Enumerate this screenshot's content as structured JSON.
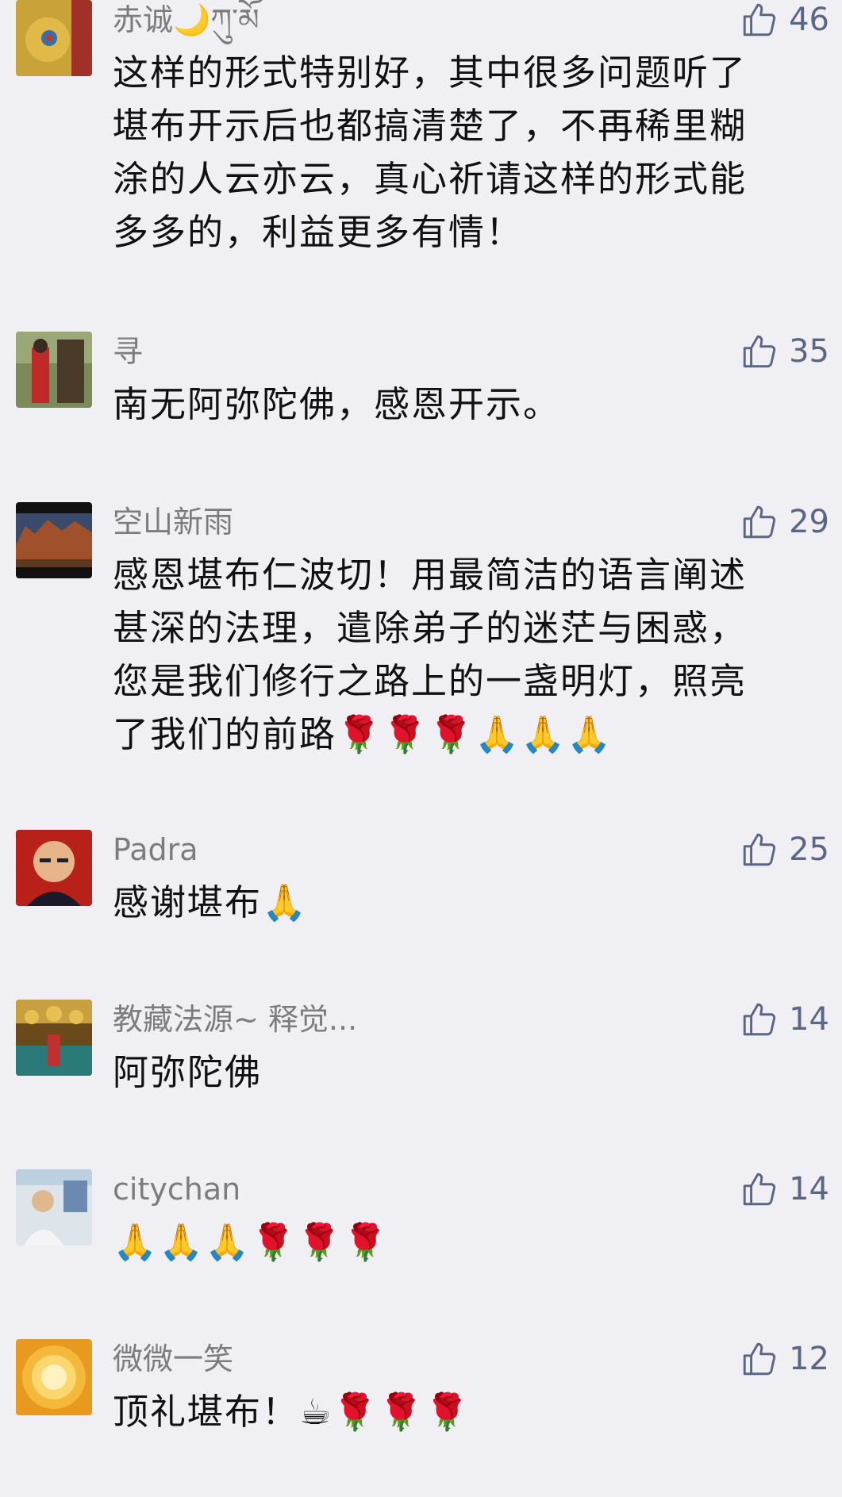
{
  "comments": [
    {
      "name": "赤诚🌙ཀུ་མོ",
      "likes": "46",
      "lines": [
        "这样的形式特别好，其中很多问题听了",
        "堪布开示后也都搞清楚了，不再稀里糊",
        "涂的人云亦云，真心祈请这样的形式能",
        "多多的，利益更多有情！"
      ]
    },
    {
      "name": "寻",
      "likes": "35",
      "lines": [
        "南无阿弥陀佛，感恩开示。"
      ]
    },
    {
      "name": "空山新雨",
      "likes": "29",
      "lines": [
        "感恩堪布仁波切！用最简洁的语言阐述",
        "甚深的法理，遣除弟子的迷茫与困惑，",
        "您是我们修行之路上的一盏明灯，照亮",
        "了我们的前路🌹🌹🌹🙏🙏🙏"
      ]
    },
    {
      "name": "Padra",
      "likes": "25",
      "lines": [
        "感谢堪布🙏"
      ]
    },
    {
      "name": "教藏法源~ 释觉...",
      "likes": "14",
      "lines": [
        "阿弥陀佛"
      ]
    },
    {
      "name": "citychan",
      "likes": "14",
      "lines": [
        "🙏🙏🙏🌹🌹🌹"
      ]
    },
    {
      "name": "微微一笑",
      "likes": "12",
      "lines": [
        "顶礼堪布！☕🌹🌹🌹"
      ]
    }
  ],
  "icons": {
    "like": "thumbs-up-icon"
  },
  "colors": {
    "background": "#f0eff4",
    "name": "#7c7c7c",
    "like": "#5a6685",
    "text": "#111111"
  }
}
